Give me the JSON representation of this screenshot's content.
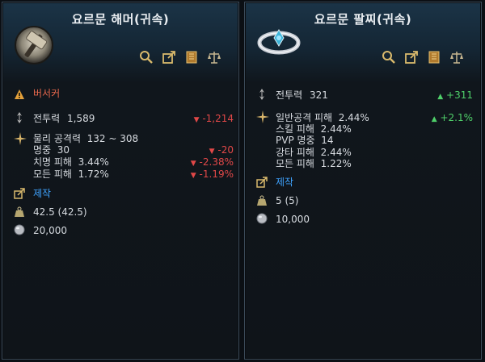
{
  "left": {
    "title": "요르문 해머(귀속)",
    "warning_label": "버서커",
    "combat_power_label": "전투력",
    "combat_power_value": "1,589",
    "combat_power_diff": "-1,214",
    "stats": [
      {
        "label": "물리 공격력",
        "value": "132 ~ 308",
        "diff": ""
      },
      {
        "label": "명중",
        "value": "30",
        "diff": "-20"
      },
      {
        "label": "치명 피해",
        "value": "3.44%",
        "diff": "-2.38%"
      },
      {
        "label": "모든 피해",
        "value": "1.72%",
        "diff": "-1.19%"
      }
    ],
    "craft_label": "제작",
    "weight_value": "42.5 (42.5)",
    "price_value": "20,000"
  },
  "right": {
    "title": "요르문 팔찌(귀속)",
    "combat_power_label": "전투력",
    "combat_power_value": "321",
    "combat_power_diff": "+311",
    "stats": [
      {
        "label": "일반공격 피해",
        "value": "2.44%",
        "diff": "+2.1%"
      },
      {
        "label": "스킬 피해",
        "value": "2.44%",
        "diff": ""
      },
      {
        "label": "PVP 명중",
        "value": "14",
        "diff": ""
      },
      {
        "label": "강타 피해",
        "value": "2.44%",
        "diff": ""
      },
      {
        "label": "모든 피해",
        "value": "1.22%",
        "diff": ""
      }
    ],
    "craft_label": "제작",
    "weight_value": "5 (5)",
    "price_value": "10,000"
  },
  "icons": [
    "search-icon",
    "external-link-icon",
    "book-icon",
    "scale-icon",
    "warning-icon",
    "combat-power-icon",
    "star-burst-icon",
    "craft-icon",
    "weight-icon",
    "coin-icon",
    "hammer-icon",
    "bracelet-icon"
  ],
  "colors": {
    "negative": "#e14848",
    "positive": "#4fd06a",
    "link": "#3fa3ff",
    "warning": "#e6674c"
  }
}
